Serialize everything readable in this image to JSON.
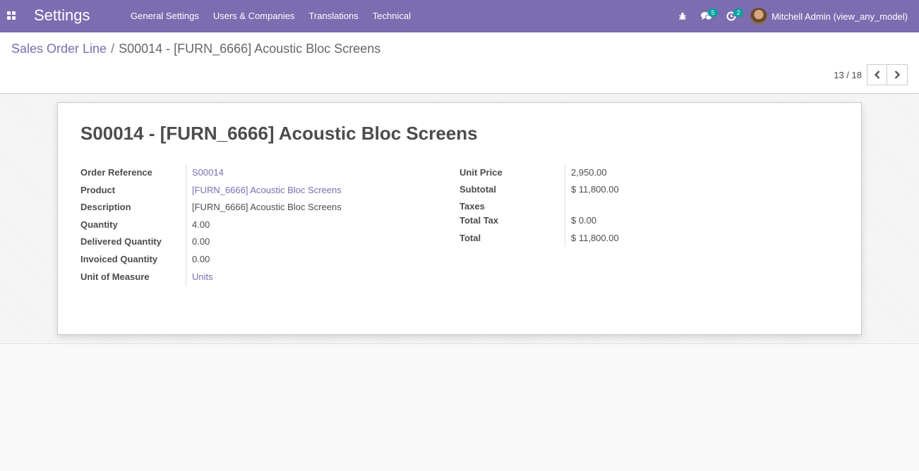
{
  "navbar": {
    "app_title": "Settings",
    "menu": [
      "General Settings",
      "Users & Companies",
      "Translations",
      "Technical"
    ],
    "messages_count": "5",
    "activities_count": "2",
    "user_name": "Mitchell Admin (view_any_model)",
    "icons": [
      "apps-icon",
      "bug-icon",
      "chat-icon",
      "clock-icon"
    ]
  },
  "breadcrumb": {
    "parent": "Sales Order Line",
    "separator": "/",
    "current": "S00014 - [FURN_6666] Acoustic Bloc Screens"
  },
  "pager": {
    "value": "13 / 18"
  },
  "form": {
    "title": "S00014 - [FURN_6666] Acoustic Bloc Screens",
    "left": [
      {
        "label": "Order Reference",
        "value": "S00014",
        "link": true
      },
      {
        "label": "Product",
        "value": "[FURN_6666] Acoustic Bloc Screens",
        "link": true
      },
      {
        "label": "Description",
        "value": "[FURN_6666] Acoustic Bloc Screens",
        "link": false
      },
      {
        "label": "Quantity",
        "value": "4.00",
        "link": false
      },
      {
        "label": "Delivered Quantity",
        "value": "0.00",
        "link": false
      },
      {
        "label": "Invoiced Quantity",
        "value": "0.00",
        "link": false
      },
      {
        "label": "Unit of Measure",
        "value": "Units",
        "link": true
      }
    ],
    "right": [
      {
        "label": "Unit Price",
        "value": "2,950.00"
      },
      {
        "label": "Subtotal",
        "value": "$ 11,800.00"
      },
      {
        "label": "Taxes",
        "value": ""
      },
      {
        "label": "Total Tax",
        "value": "$ 0.00"
      },
      {
        "label": "Total",
        "value": "$ 11,800.00"
      }
    ]
  },
  "colors": {
    "navbar": "#7c6cb0",
    "link": "#7c6cb0",
    "badge": "#00a09d"
  }
}
